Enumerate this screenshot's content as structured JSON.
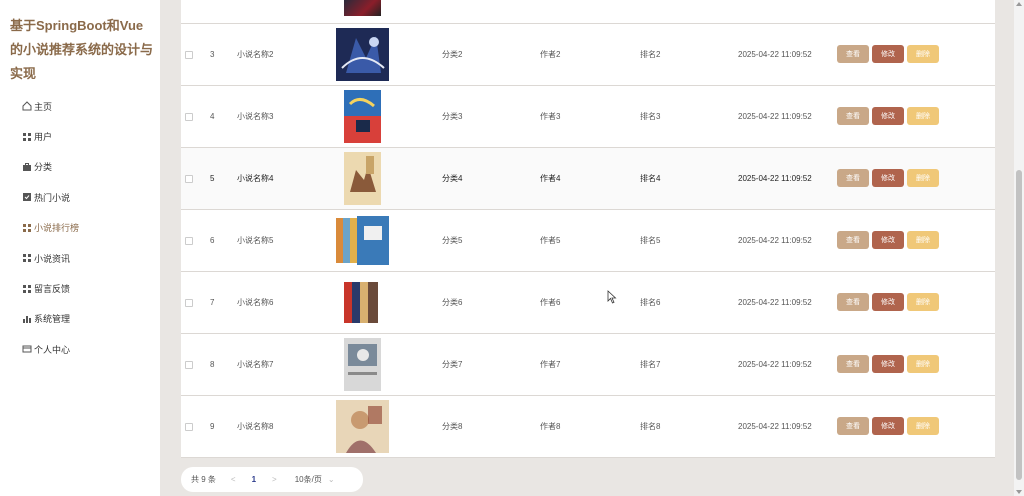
{
  "app": {
    "title": "基于SpringBoot和Vue的小说推荐系统的设计与实现"
  },
  "sidebar": {
    "items": [
      {
        "label": "主页",
        "icon": "home-icon"
      },
      {
        "label": "用户",
        "icon": "grid-icon"
      },
      {
        "label": "分类",
        "icon": "briefcase-icon"
      },
      {
        "label": "热门小说",
        "icon": "check-square-icon"
      },
      {
        "label": "小说排行榜",
        "icon": "grid-icon"
      },
      {
        "label": "小说资讯",
        "icon": "grid-icon"
      },
      {
        "label": "留言反馈",
        "icon": "grid-icon"
      },
      {
        "label": "系统管理",
        "icon": "bar-chart-icon"
      },
      {
        "label": "个人中心",
        "icon": "id-card-icon"
      }
    ]
  },
  "table": {
    "rows": [
      {
        "index": "3",
        "name": "小说名称2",
        "category": "分类2",
        "author": "作者2",
        "rank": "排名2",
        "time": "2025-04-22 11:09:52"
      },
      {
        "index": "4",
        "name": "小说名称3",
        "category": "分类3",
        "author": "作者3",
        "rank": "排名3",
        "time": "2025-04-22 11:09:52"
      },
      {
        "index": "5",
        "name": "小说名称4",
        "category": "分类4",
        "author": "作者4",
        "rank": "排名4",
        "time": "2025-04-22 11:09:52"
      },
      {
        "index": "6",
        "name": "小说名称5",
        "category": "分类5",
        "author": "作者5",
        "rank": "排名5",
        "time": "2025-04-22 11:09:52"
      },
      {
        "index": "7",
        "name": "小说名称6",
        "category": "分类6",
        "author": "作者6",
        "rank": "排名6",
        "time": "2025-04-22 11:09:52"
      },
      {
        "index": "8",
        "name": "小说名称7",
        "category": "分类7",
        "author": "作者7",
        "rank": "排名7",
        "time": "2025-04-22 11:09:52"
      },
      {
        "index": "9",
        "name": "小说名称8",
        "category": "分类8",
        "author": "作者8",
        "rank": "排名8",
        "time": "2025-04-22 11:09:52"
      }
    ],
    "actions": {
      "view": "查看",
      "edit": "修改",
      "delete": "删除"
    }
  },
  "pagination": {
    "total": "共 9 条",
    "prev": "<",
    "current_page": "1",
    "next": ">",
    "page_size": "10条/页",
    "size_caret": "⌄"
  },
  "colors": {
    "accent": "#8a6a4a",
    "view_button": "#c9a888",
    "edit_button": "#b0644d",
    "delete_button": "#f0c878",
    "page_active": "#2b3a8c"
  }
}
